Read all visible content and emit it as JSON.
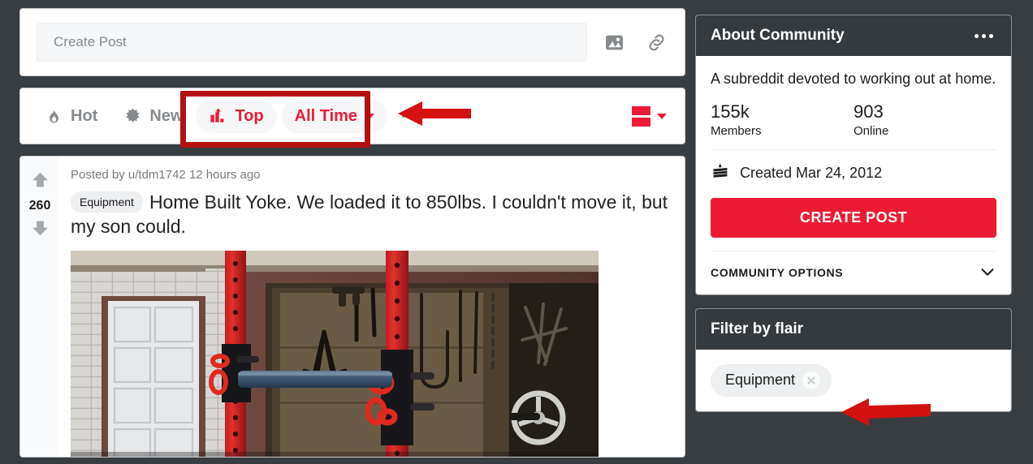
{
  "theme": {
    "page_background": "#373d41",
    "accent_red": "#ed1c34",
    "panel_header": "#343a3e",
    "annotation_red": "#b51010",
    "arrow_red": "#d41111",
    "muted_gray": "#878a8c"
  },
  "create_post": {
    "placeholder": "Create Post",
    "image_icon": "image-icon",
    "link_icon": "link-icon"
  },
  "sort_bar": {
    "items": [
      {
        "label": "Hot",
        "icon": "flame-icon",
        "active": false
      },
      {
        "label": "New",
        "icon": "sparkle-icon",
        "active": false
      },
      {
        "label": "Top",
        "icon": "bar-chart-up-icon",
        "active": true
      }
    ],
    "time_filter": {
      "label": "All Time",
      "icon": "chevron-down-icon"
    },
    "more_label": "...",
    "view_mode": {
      "icon": "card-view-icon",
      "caret": "chevron-down-icon"
    }
  },
  "post": {
    "score": "260",
    "upvote_icon": "arrow-up-icon",
    "downvote_icon": "arrow-down-icon",
    "meta_prefix": "Posted by",
    "author": "u/tdm1742",
    "timestamp": "12 hours ago",
    "flair": "Equipment",
    "title": "Home Built Yoke. We loaded it to 850lbs. I couldn't move it, but my son could.",
    "image_alt": "Home built red and black steel yoke with blue crossbar mounted in a garage doorway"
  },
  "about_community": {
    "title": "About Community",
    "menu_icon": "ellipsis-icon",
    "description": "A subreddit devoted to working out at home.",
    "stats": [
      {
        "value": "155k",
        "label": "Members"
      },
      {
        "value": "903",
        "label": "Online"
      }
    ],
    "created_icon": "cake-icon",
    "created_text": "Created Mar 24, 2012",
    "create_post_button": "CREATE POST",
    "community_options_label": "COMMUNITY OPTIONS",
    "community_options_icon": "chevron-down-icon"
  },
  "filter_by_flair": {
    "title": "Filter by flair",
    "chips": [
      {
        "label": "Equipment",
        "remove_icon": "close-icon"
      }
    ]
  },
  "annotations": {
    "highlight_box": {
      "target": "sort-top-alltime-group"
    },
    "arrows": [
      {
        "target": "sort-top-alltime-group",
        "direction": "left"
      },
      {
        "target": "flair-chip-equipment",
        "direction": "left"
      }
    ]
  }
}
